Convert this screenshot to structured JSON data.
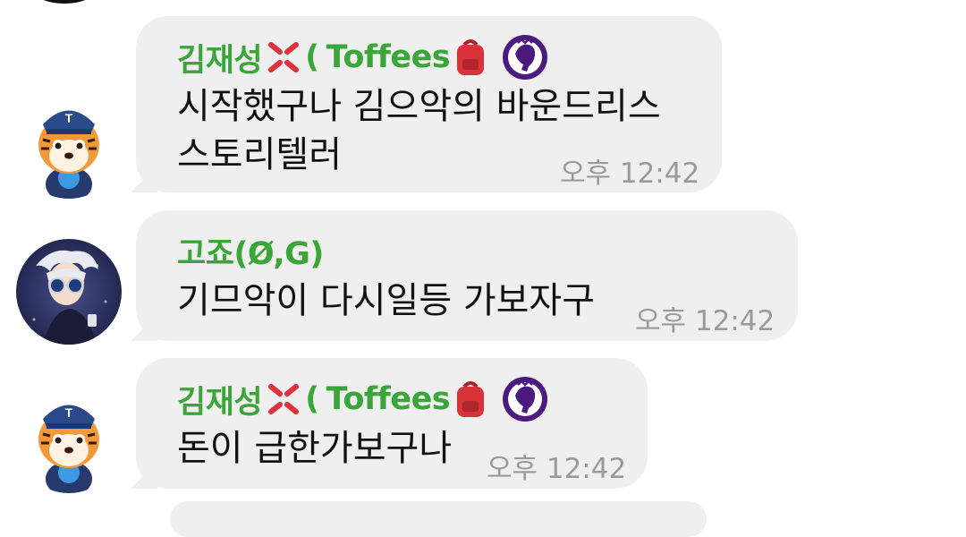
{
  "messages": [
    {
      "sender": "김재성",
      "sender_suffix": "Toffees",
      "lines": [
        "시작했구나 김으악의 바운드리스",
        "스토리텔러"
      ],
      "time": "오후 12:42",
      "avatar": "tiger-avatar"
    },
    {
      "sender": "고죠(Ø,G)",
      "sender_suffix": "",
      "lines": [
        "기므악이 다시일등 가보자구"
      ],
      "time": "오후 12:42",
      "avatar": "anime-character-avatar"
    },
    {
      "sender": "김재성",
      "sender_suffix": "Toffees",
      "lines": [
        "돈이 급한가보구나"
      ],
      "time": "오후 12:42",
      "avatar": "tiger-avatar"
    }
  ],
  "colors": {
    "sender_name": "#3aa538",
    "bubble": "#efefef",
    "timestamp": "#9a9a9a",
    "premier_league_purple": "#4b1a7f"
  },
  "icons": [
    "anger-emoji",
    "backpack-emoji",
    "premier-league-lion-icon"
  ]
}
